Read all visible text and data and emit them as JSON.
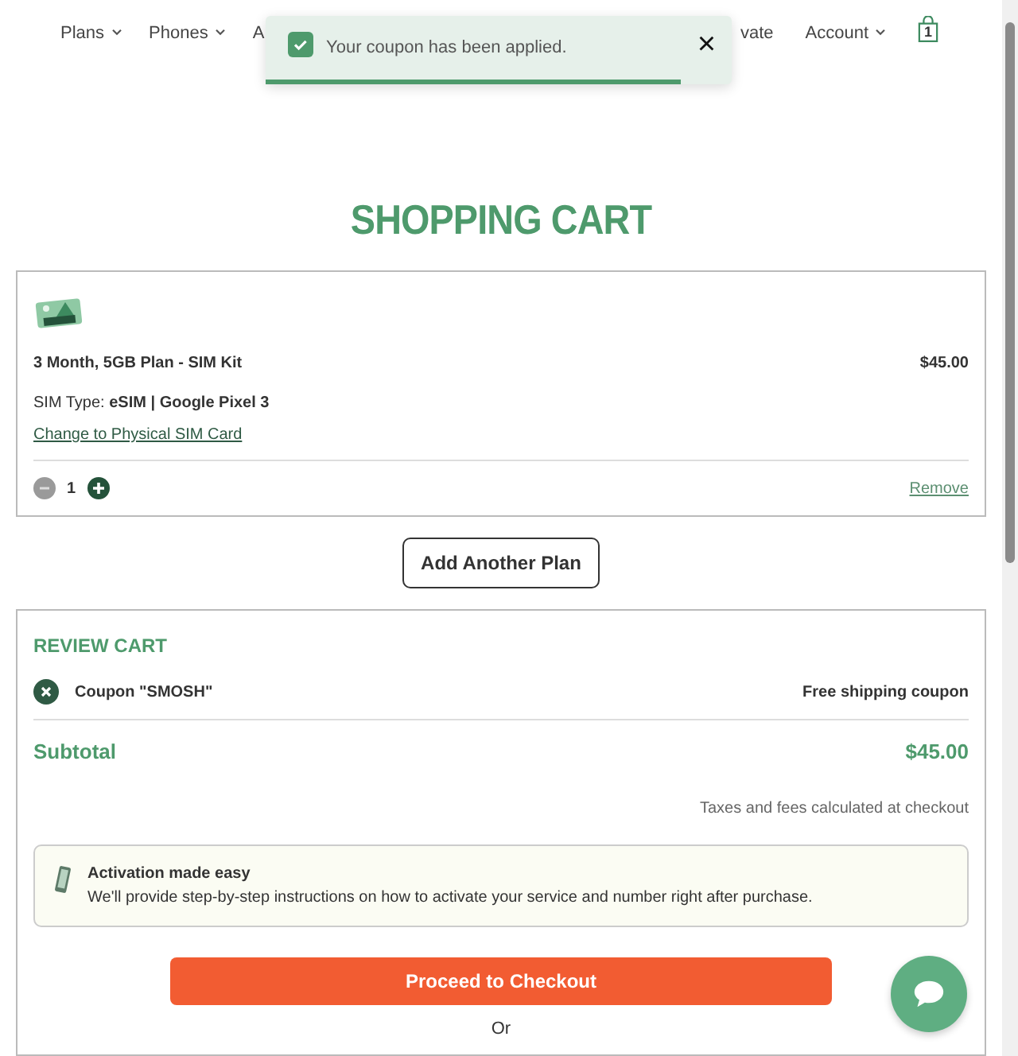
{
  "nav": {
    "items": [
      {
        "label": "Plans",
        "chevron": true
      },
      {
        "label": "Phones",
        "chevron": true
      },
      {
        "label": "A",
        "chevron": false
      }
    ],
    "right_items": [
      {
        "label": "vate",
        "chevron": false
      },
      {
        "label": "Account",
        "chevron": true
      }
    ],
    "cart_count": "1"
  },
  "toast": {
    "message": "Your coupon has been applied.",
    "close": "×",
    "level": 0.89
  },
  "title": "SHOPPING CART",
  "cart_item": {
    "name": "3 Month, 5GB Plan - SIM Kit",
    "price": "$45.00",
    "sim_type": "SIM Type: **eSIM | Google Pixel 3**",
    "change_link": "Change to Physical SIM Card",
    "quantity": "1",
    "remove": "Remove"
  },
  "add_plan": "Add Another Plan",
  "review": {
    "heading": "REVIEW CART",
    "coupon": "Coupon \"SMOSH\"",
    "coupon_note": "Free shipping coupon",
    "subtotal_label": "Subtotal",
    "subtotal": "$45.00",
    "taxes": "Taxes and fees calculated at checkout",
    "info_title": "Activation made easy",
    "info_text": "We'll provide step-by-step instructions on how to activate your service and number right after purchase.",
    "checkout": "Proceed to Checkout",
    "or": "Or"
  }
}
